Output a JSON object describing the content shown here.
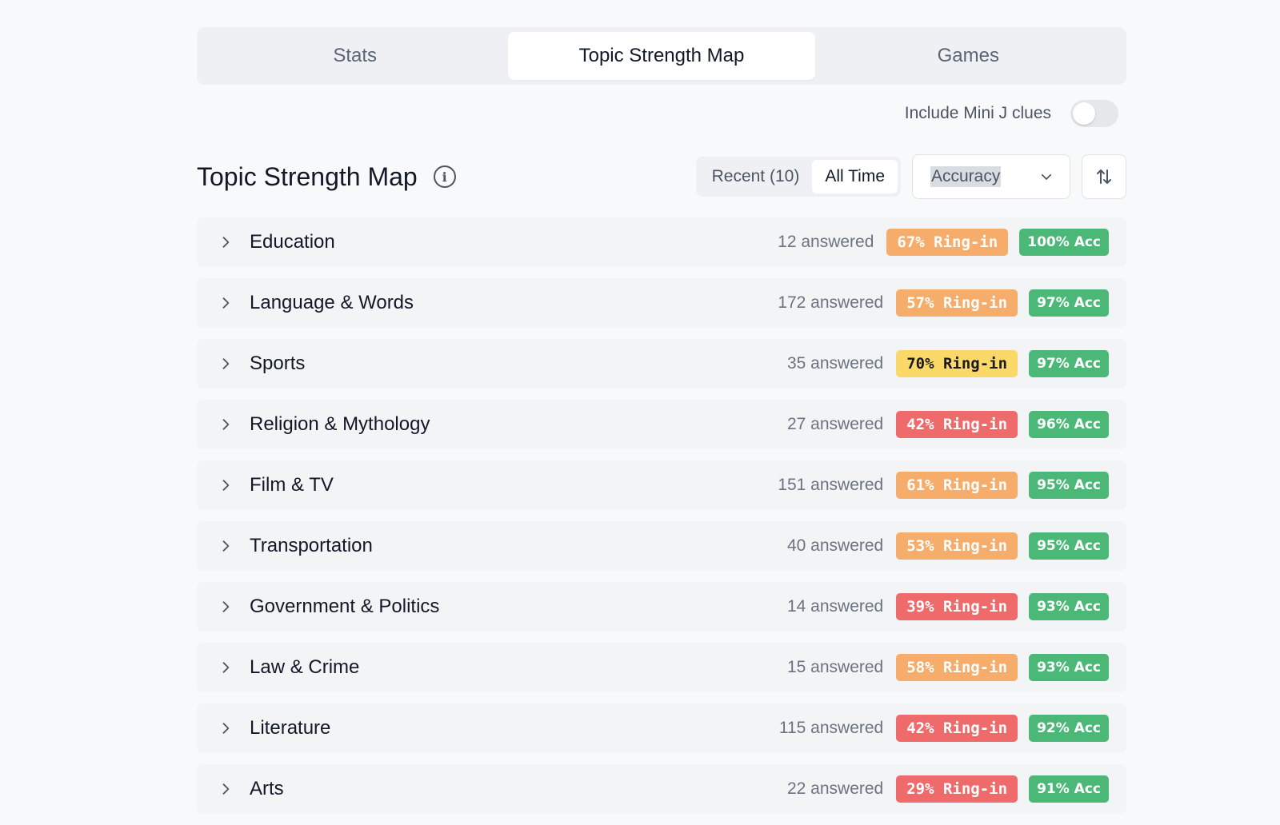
{
  "tabs": [
    {
      "label": "Stats",
      "active": false
    },
    {
      "label": "Topic Strength Map",
      "active": true
    },
    {
      "label": "Games",
      "active": false
    }
  ],
  "mini_j": {
    "label": "Include Mini J clues",
    "enabled": false
  },
  "header": {
    "title": "Topic Strength Map"
  },
  "range": {
    "recent_label": "Recent (10)",
    "all_time_label": "All Time",
    "selected": "All Time"
  },
  "sort_select": {
    "value": "Accuracy"
  },
  "colors": {
    "orange": "#f6ad6b",
    "yellow": "#fbd969",
    "red": "#ef6b6b",
    "green": "#4cb878",
    "text_dark": "#1a1a1a"
  },
  "topics": [
    {
      "name": "Education",
      "answered": "12 answered",
      "ring_in": "67% Ring-in",
      "ring_color": "orange",
      "acc": "100% Acc"
    },
    {
      "name": "Language & Words",
      "answered": "172 answered",
      "ring_in": "57% Ring-in",
      "ring_color": "orange",
      "acc": "97% Acc"
    },
    {
      "name": "Sports",
      "answered": "35 answered",
      "ring_in": "70% Ring-in",
      "ring_color": "yellow",
      "acc": "97% Acc"
    },
    {
      "name": "Religion & Mythology",
      "answered": "27 answered",
      "ring_in": "42% Ring-in",
      "ring_color": "red",
      "acc": "96% Acc"
    },
    {
      "name": "Film & TV",
      "answered": "151 answered",
      "ring_in": "61% Ring-in",
      "ring_color": "orange",
      "acc": "95% Acc"
    },
    {
      "name": "Transportation",
      "answered": "40 answered",
      "ring_in": "53% Ring-in",
      "ring_color": "orange",
      "acc": "95% Acc"
    },
    {
      "name": "Government & Politics",
      "answered": "14 answered",
      "ring_in": "39% Ring-in",
      "ring_color": "red",
      "acc": "93% Acc"
    },
    {
      "name": "Law & Crime",
      "answered": "15 answered",
      "ring_in": "58% Ring-in",
      "ring_color": "orange",
      "acc": "93% Acc"
    },
    {
      "name": "Literature",
      "answered": "115 answered",
      "ring_in": "42% Ring-in",
      "ring_color": "red",
      "acc": "92% Acc"
    },
    {
      "name": "Arts",
      "answered": "22 answered",
      "ring_in": "29% Ring-in",
      "ring_color": "red",
      "acc": "91% Acc"
    }
  ]
}
